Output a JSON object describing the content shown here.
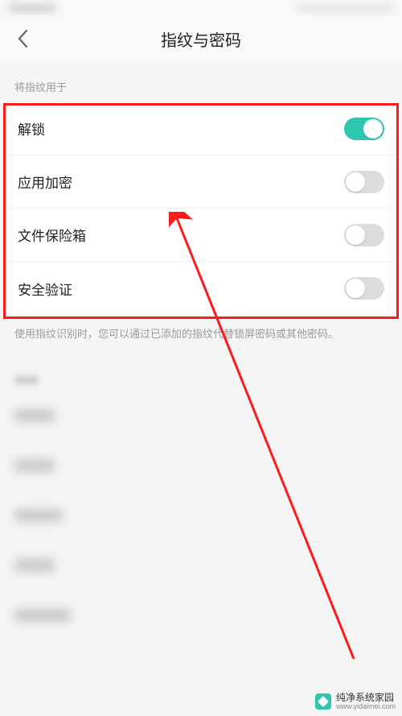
{
  "header": {
    "title": "指纹与密码"
  },
  "section": {
    "header": "将指纹用于"
  },
  "rows": [
    {
      "label": "解锁",
      "state": "on"
    },
    {
      "label": "应用加密",
      "state": "off"
    },
    {
      "label": "文件保险箱",
      "state": "off"
    },
    {
      "label": "安全验证",
      "state": "off"
    }
  ],
  "footer": {
    "text": "使用指纹识别时，您可以通过已添加的指纹代替锁屏密码或其他密码。"
  },
  "watermark": {
    "name": "纯净系统家园",
    "url": "www.yidaimei.com"
  },
  "annotation": {
    "highlight_color": "#ff1a1a"
  }
}
